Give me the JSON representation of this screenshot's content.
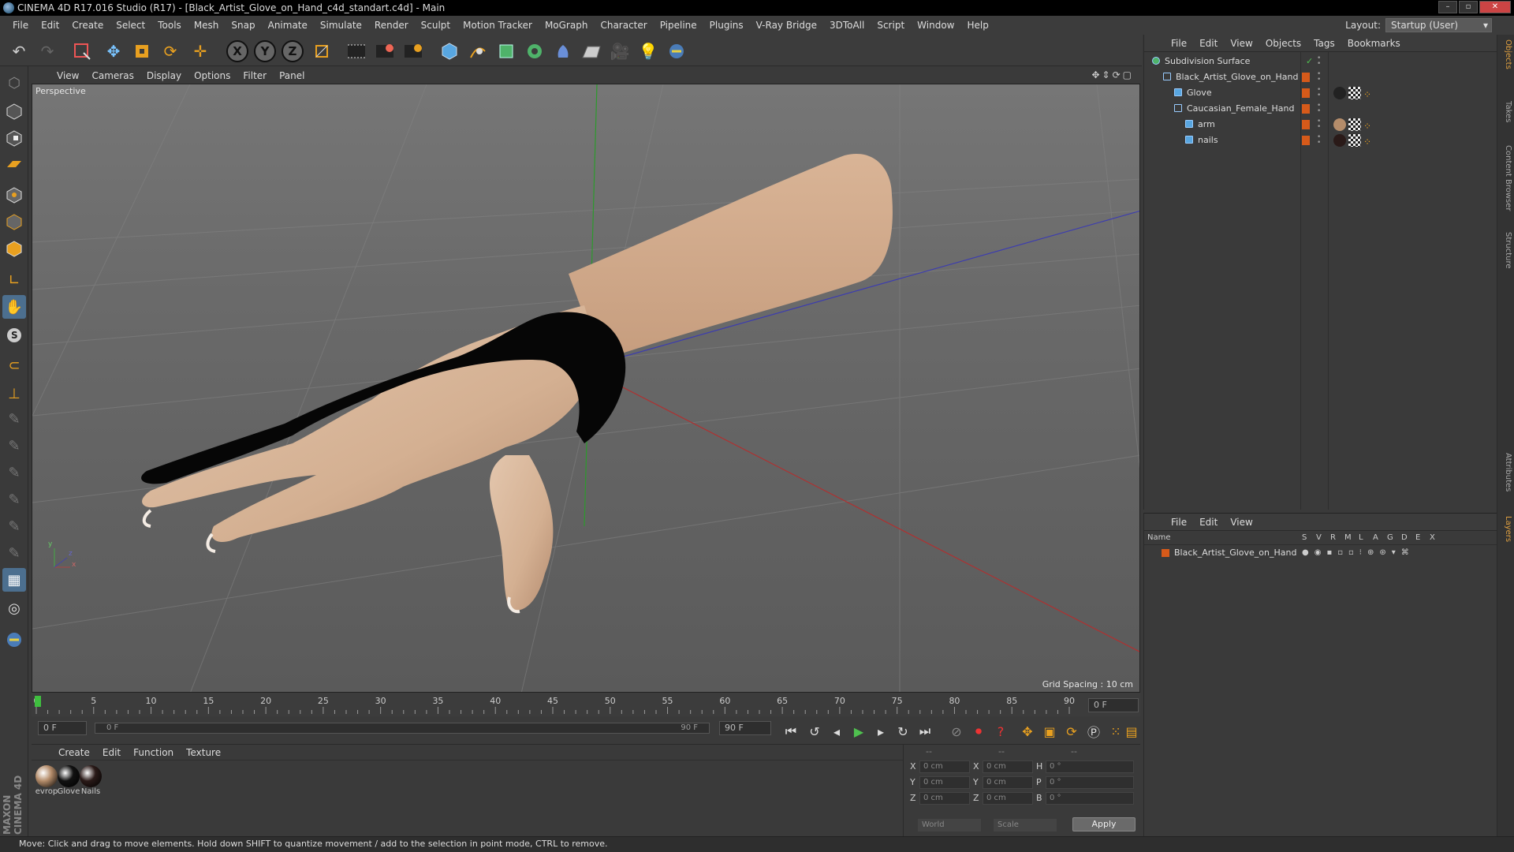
{
  "window": {
    "title": "CINEMA 4D R17.016 Studio (R17) - [Black_Artist_Glove_on_Hand_c4d_standart.c4d] - Main"
  },
  "menu": [
    "File",
    "Edit",
    "Create",
    "Select",
    "Tools",
    "Mesh",
    "Snap",
    "Animate",
    "Simulate",
    "Render",
    "Sculpt",
    "Motion Tracker",
    "MoGraph",
    "Character",
    "Pipeline",
    "Plugins",
    "V-Ray Bridge",
    "3DToAll",
    "Script",
    "Window",
    "Help"
  ],
  "layout": {
    "label": "Layout:",
    "value": "Startup (User)"
  },
  "toolbar": {
    "axis_x": "X",
    "axis_y": "Y",
    "axis_z": "Z"
  },
  "viewport": {
    "menu": [
      "View",
      "Cameras",
      "Display",
      "Options",
      "Filter",
      "Panel"
    ],
    "label": "Perspective",
    "grid_spacing": "Grid Spacing : 10 cm",
    "axis_y": "y",
    "axis_z": "z",
    "axis_x": "x"
  },
  "timeline": {
    "ticks": [
      "0",
      "5",
      "10",
      "15",
      "20",
      "25",
      "30",
      "35",
      "40",
      "45",
      "50",
      "55",
      "60",
      "65",
      "70",
      "75",
      "80",
      "85",
      "90"
    ],
    "current_frame": "0 F",
    "start_field": "0 F",
    "range_start": "0 F",
    "range_end": "90 F",
    "end_field": "90 F",
    "playhead_frame": 0,
    "max_frame": 90
  },
  "materials": {
    "menu": [
      "Create",
      "Edit",
      "Function",
      "Texture"
    ],
    "items": [
      {
        "name": "evrop",
        "color": "#b48c6a"
      },
      {
        "name": "Glove",
        "color": "#111111"
      },
      {
        "name": "Nails",
        "color": "#2a1a18"
      }
    ]
  },
  "coords": {
    "headers": [
      "--",
      "--",
      "--"
    ],
    "rows": [
      {
        "pos_label": "X",
        "pos": "0 cm",
        "size_label": "X",
        "size": "0 cm",
        "rot_label": "H",
        "rot": "0 °"
      },
      {
        "pos_label": "Y",
        "pos": "0 cm",
        "size_label": "Y",
        "size": "0 cm",
        "rot_label": "P",
        "rot": "0 °"
      },
      {
        "pos_label": "Z",
        "pos": "0 cm",
        "size_label": "Z",
        "size": "0 cm",
        "rot_label": "B",
        "rot": "0 °"
      }
    ],
    "mode": "World",
    "transform": "Scale",
    "apply": "Apply"
  },
  "objects": {
    "menu": [
      "File",
      "Edit",
      "View",
      "Objects",
      "Tags",
      "Bookmarks"
    ],
    "items": [
      {
        "name": "Subdivision Surface",
        "indent": 0,
        "icon": "subdivision-icon"
      },
      {
        "name": "Black_Artist_Glove_on_Hand",
        "indent": 1,
        "icon": "null-icon"
      },
      {
        "name": "Glove",
        "indent": 2,
        "icon": "polygon-icon"
      },
      {
        "name": "Caucasian_Female_Hand",
        "indent": 2,
        "icon": "null-icon"
      },
      {
        "name": "arm",
        "indent": 3,
        "icon": "polygon-icon"
      },
      {
        "name": "nails",
        "indent": 3,
        "icon": "polygon-icon"
      }
    ]
  },
  "layers": {
    "menu": [
      "File",
      "Edit",
      "View"
    ],
    "columns": [
      "Name",
      "S",
      "V",
      "R",
      "M",
      "L",
      "A",
      "G",
      "D",
      "E",
      "X"
    ],
    "rows": [
      {
        "name": "Black_Artist_Glove_on_Hand",
        "color": "#d65a1a"
      }
    ]
  },
  "right_tabs": [
    "Objects",
    "Takes",
    "Content Browser",
    "Structure",
    "Attributes",
    "Layers"
  ],
  "status": "Move: Click and drag to move elements. Hold down SHIFT to quantize movement / add to the selection in point mode, CTRL to remove.",
  "logo": {
    "brand": "MAXON",
    "product": "CINEMA 4D"
  }
}
